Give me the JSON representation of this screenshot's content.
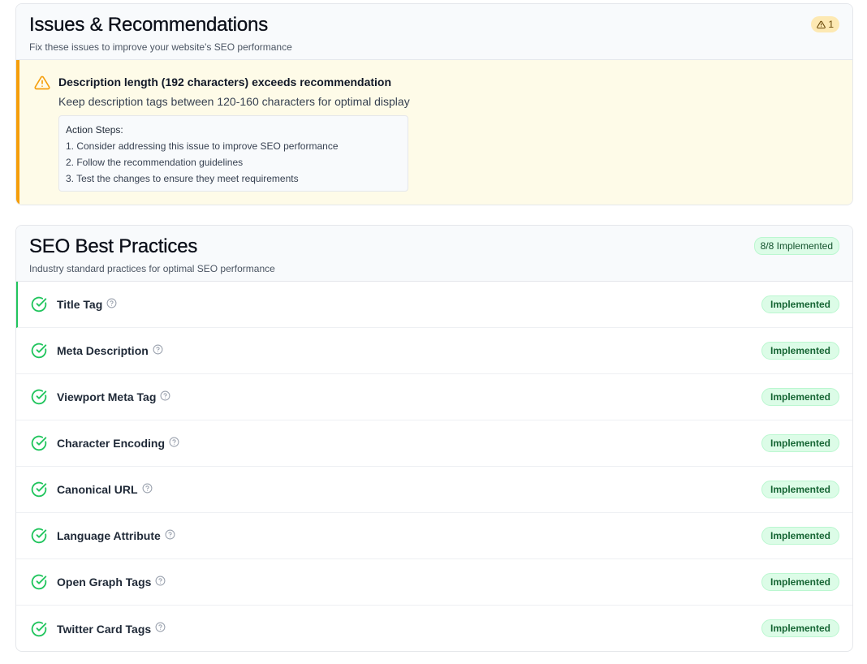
{
  "issues": {
    "title": "Issues & Recommendations",
    "subtitle": "Fix these issues to improve your website's SEO performance",
    "count": "1",
    "items": [
      {
        "title": "Description length (192 characters) exceeds recommendation",
        "description": "Keep description tags between 120-160 characters for optimal display",
        "steps_title": "Action Steps:",
        "steps": [
          "1. Consider addressing this issue to improve SEO performance",
          "2. Follow the recommendation guidelines",
          "3. Test the changes to ensure they meet requirements"
        ]
      }
    ]
  },
  "practices": {
    "title": "SEO Best Practices",
    "subtitle": "Industry standard practices for optimal SEO performance",
    "badge": "8/8 Implemented",
    "status_label": "Implemented",
    "items": [
      {
        "label": "Title Tag",
        "status": "Implemented"
      },
      {
        "label": "Meta Description",
        "status": "Implemented"
      },
      {
        "label": "Viewport Meta Tag",
        "status": "Implemented"
      },
      {
        "label": "Character Encoding",
        "status": "Implemented"
      },
      {
        "label": "Canonical URL",
        "status": "Implemented"
      },
      {
        "label": "Language Attribute",
        "status": "Implemented"
      },
      {
        "label": "Open Graph Tags",
        "status": "Implemented"
      },
      {
        "label": "Twitter Card Tags",
        "status": "Implemented"
      }
    ]
  },
  "icons": {
    "warning": "warning-triangle-icon",
    "check": "check-circle-icon",
    "help": "help-circle-icon"
  },
  "colors": {
    "warning_accent": "#f59e0b",
    "success": "#22c55e",
    "success_bg": "#dcfce7"
  }
}
